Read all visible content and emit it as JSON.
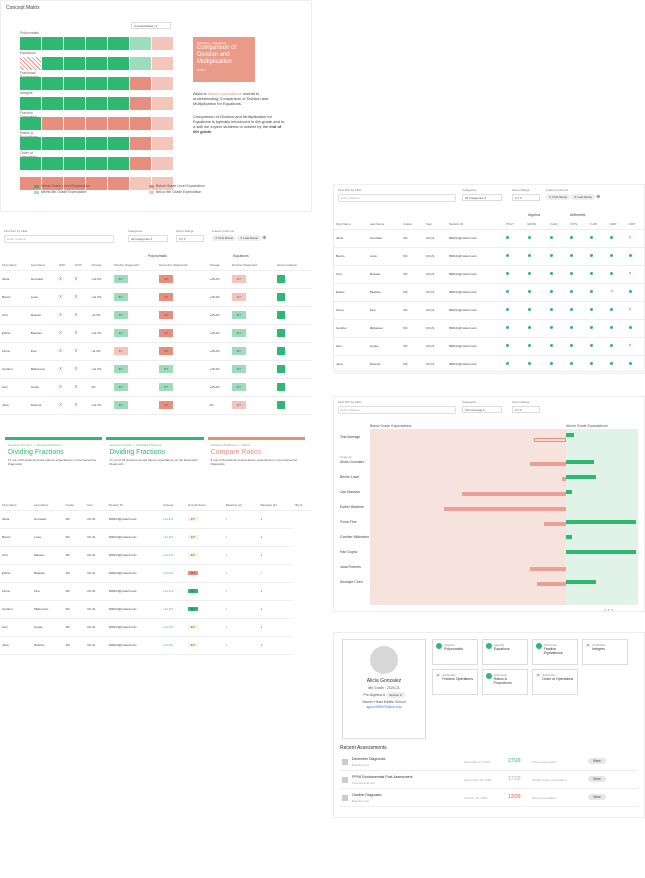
{
  "matrix": {
    "title": "Concept Matrix",
    "dropdown": "Overall Mastery",
    "rows": [
      [
        "Polynomials",
        "gc",
        "gc",
        "gc",
        "gc",
        "gc",
        "gl",
        "rl"
      ],
      [
        "Equations",
        "hat",
        "gc",
        "gc",
        "gc",
        "gc",
        "gl",
        "rl"
      ],
      [
        "Fractional Expressions",
        "gc",
        "gc",
        "gc",
        "gc",
        "gc",
        "rm",
        "rl"
      ],
      [
        "Integers",
        "gc",
        "gc",
        "gc",
        "gc",
        "gc",
        "rm",
        "rl"
      ],
      [
        "Fraction Operations",
        "gc",
        "rm",
        "rm",
        "rm",
        "rm",
        "rm",
        "rl"
      ],
      [
        "Ratios & Proportions",
        "gc",
        "gc",
        "gc",
        "gc",
        "gc",
        "rm",
        "rl"
      ],
      [
        "Order of Operations",
        "gc",
        "gc",
        "gc",
        "gc",
        "gc",
        "rm",
        "rl"
      ],
      [
        "",
        "rm",
        "rm",
        "rm",
        "rm",
        "rm",
        "rl",
        "rl"
      ]
    ],
    "legend": [
      "Meets Grade Level Expectation",
      "Below Grade Level Expectation",
      "Meets 8th Grade Expectation",
      "Below 8th Grade Expectation"
    ],
    "panel_kicker": "Fractions + Equations",
    "panel_title": "Comparison of Division and Multiplication",
    "panel_sub": "6.NS.1",
    "desc1_a": "Alicia is ",
    "desc1_b": "below expectations",
    "desc1_c": " overall in understanding Comparison of Division and Multiplication for Equations.",
    "desc2_a": "Comparison of Division and Multiplication for Equations is typically introduced in 6th grade and is a skill we expect students to master by the ",
    "desc2_b": "end of 6th grade."
  },
  "search": {
    "label": "Find Sort by Filter",
    "placeholder": "Enter Student...",
    "cat_label": "Categories",
    "cat_value": "All Categories",
    "range_label": "Score Range",
    "range_value": "0-7",
    "freeze_label": "Freeze Columns",
    "chip1": "First Name",
    "chip2": "Last Name"
  },
  "left_table": {
    "cols": [
      "First Name",
      "Last Name",
      "R&P",
      "OOP",
      "Change",
      "October Diagnostic",
      "December Diagnostic",
      "Change",
      "October Diagnostic",
      "Decem Diagno"
    ],
    "group1": "Polynomials",
    "group2": "Equations",
    "rows": [
      [
        "Alicia",
        "Gonzalez",
        "x",
        "x",
        "+11.2%",
        "6/7",
        "4/7",
        "+15.2%",
        "4/7",
        ""
      ],
      [
        "Benito",
        "Lowe",
        "x",
        "x",
        "+11.2%",
        "6/7",
        "4/7",
        "+15.2%",
        "4/7",
        ""
      ],
      [
        "Carl",
        "Massan",
        "x",
        "x",
        "-11.3%",
        "6/7",
        "4/7",
        "+15.2%",
        "6/7",
        ""
      ],
      [
        "Esther",
        "Beatrise",
        "x",
        "x",
        "+11.2%",
        "6/7",
        "4/7",
        "+15.2%",
        "6/7",
        ""
      ],
      [
        "Fiona",
        "Fine",
        "x",
        "x",
        "-11.2%",
        "3/7",
        "4/7",
        "+15.2%",
        "6/7",
        ""
      ],
      [
        "Gunther",
        "Mikkenson",
        "x",
        "x",
        "+11.2%",
        "6/7",
        "6/7",
        "+15.2%",
        "6/7",
        ""
      ],
      [
        "Hari",
        "Gupta",
        "x",
        "x",
        "0%",
        "6/7",
        "6/7",
        "+15.2%",
        "6/7",
        ""
      ],
      [
        "Jana",
        "Roberts",
        "x",
        "x",
        "+11.2%",
        "6/7",
        "4/7",
        "0%",
        "3/7",
        ""
      ]
    ]
  },
  "right_table": {
    "group1": "Algebra",
    "group2": "Arithmetic",
    "cols": [
      "First Name",
      "Last Name",
      "Grade",
      "Year",
      "Student ID",
      "POLY",
      "EQNS",
      "F-EQ",
      "INTS",
      "F-OP",
      "R&P",
      "OOP"
    ],
    "rows": [
      [
        "Alicia",
        "Gonzalez",
        "6th",
        "'20-'21",
        "998124@mdsch.edu"
      ],
      [
        "Benito",
        "Lowe",
        "6th",
        "'20-'21",
        "998124@mdsch.edu"
      ],
      [
        "Carl",
        "Massan",
        "6th",
        "'20-'21",
        "998124@mdsch.edu"
      ],
      [
        "Esther",
        "Beatrise",
        "6th",
        "'20-'21",
        "998124@mdsch.edu"
      ],
      [
        "Fiona",
        "Fine",
        "6th",
        "'20-'21",
        "998124@mdsch.edu"
      ],
      [
        "Gunther",
        "Mikkelsen",
        "6th",
        "'20-'21",
        "998124@mdsch.edu"
      ],
      [
        "Hari",
        "Gupta",
        "6th",
        "'20-'21",
        "998124@mdsch.edu"
      ],
      [
        "Jana",
        "Roberts",
        "6th",
        "'20-'21",
        "998124@mdsch.edu"
      ]
    ]
  },
  "cards": [
    {
      "kicker": "Greatest Strength — Standard Practices",
      "title": "Dividing Fractions",
      "desc": "17 out of 25 students scored above expectations on the December Diagnostic.",
      "color": "#2eb872"
    },
    {
      "kicker": "Greatest Growth — Standard Practices",
      "title": "Dividing Fractions",
      "desc": "17 out of 25 students scored above expectations on the December Diagnostic.",
      "color": "#2eb872"
    },
    {
      "kicker": "Greatest Weakness — Ratios",
      "title": "Compare Ratios",
      "desc": "8 out of 25 students scored above expectations on the December Diagnostic.",
      "color": "#e88e7f"
    }
  ],
  "bottom_table": {
    "cols": [
      "First Name",
      "Last Name",
      "Grade",
      "Year",
      "Student ID",
      "Change",
      "Overall Score",
      "Baseline Q1",
      "Baseline Q2",
      "Ba Q"
    ],
    "rows": [
      [
        "Alicia",
        "Gonzalez",
        "6th",
        "'20-'21",
        "998124@mdsch.edu",
        "+11.2%",
        "4/7",
        "x",
        "●"
      ],
      [
        "Benito",
        "Lowe",
        "6th",
        "'20-'21",
        "998124@mdsch.edu",
        "+11.2%",
        "4/7",
        "x",
        "●"
      ],
      [
        "Carl",
        "Massan",
        "6th",
        "'20-'21",
        "998124@mdsch.edu",
        "+11.2%",
        "4/7",
        "x",
        "●"
      ],
      [
        "Esther",
        "Beatrise",
        "6th",
        "'20-'21",
        "998124@mdsch.edu",
        "+11.2%",
        "3/7",
        "x",
        "x"
      ],
      [
        "Fiona",
        "Fine",
        "6th",
        "'20-'21",
        "998124@mdsch.edu",
        "+11.2%",
        "6/7",
        "x",
        "●"
      ],
      [
        "Gunther",
        "Mikkenson",
        "6th",
        "'20-'21",
        "998124@mdsch.edu",
        "+11.2%",
        "6/7",
        "x",
        "●"
      ],
      [
        "Hari",
        "Gupta",
        "6th",
        "'20-'21",
        "998124@mdsch.edu",
        "+11.2%",
        "4/7",
        "x",
        "●"
      ],
      [
        "Jana",
        "Roberts",
        "6th",
        "'20-'21",
        "998124@mdsch.edu",
        "+11.2%",
        "4/7",
        "x",
        "●"
      ]
    ]
  },
  "bars": {
    "below": "Below Grade Expectations",
    "above": "Above Grade Expectations",
    "test_avg": "Test Average",
    "students_label": "Students",
    "range_value": "Test Average",
    "names": [
      "Alicia Gonzalez",
      "Benito Lowe",
      "Carl Massan",
      "Esther Beatrise",
      "Fiona Fine",
      "Gunther Mikkelsen",
      "Hari Gupta",
      "Jana Roberts",
      "Monique Chen"
    ]
  },
  "profile": {
    "name": "Alicia Gonzalez",
    "grade": "6th Grade",
    "year": "2020-21",
    "course": "Pre-Algebra A",
    "section": "Section 2",
    "school": "Sacred Heart Middle School",
    "email": "agonz998476@sh.edu",
    "concepts": [
      {
        "group": "Algebra",
        "name": "Polynomials",
        "ok": true
      },
      {
        "group": "Algebra",
        "name": "Equations",
        "ok": true
      },
      {
        "group": "Arithmetic",
        "name": "Fraction Equivalence",
        "ok": true
      },
      {
        "group": "Arithmetic",
        "name": "Integers",
        "ok": false
      },
      {
        "group": "Arithmetic",
        "name": "Fraction Operations",
        "ok": false
      },
      {
        "group": "Arithmetic",
        "name": "Ratios & Proportions",
        "ok": true
      },
      {
        "group": "Arithmetic",
        "name": "Order of Operations",
        "ok": false
      }
    ],
    "recent": "Recent Assessments",
    "assessments": [
      {
        "name": "December Diagnostic",
        "sub": "Baseline test",
        "date": "December 14, 2020",
        "score": "27/29",
        "scolor": "#2eb872",
        "status": "Above expectation",
        "btn": "View"
      },
      {
        "name": "FPRA Fundamentals Post-Assessment",
        "sub": "Post-assessment",
        "date": "September 30, 2020",
        "score": "17/29",
        "scolor": "#aaa",
        "status": "Slightly below expectation",
        "btn": "View"
      },
      {
        "name": "October Diagnostic",
        "sub": "Baseline test",
        "date": "October 18, 2020",
        "score": "12/29",
        "scolor": "#e05a4a",
        "status": "Below expectation",
        "btn": "View"
      }
    ]
  }
}
